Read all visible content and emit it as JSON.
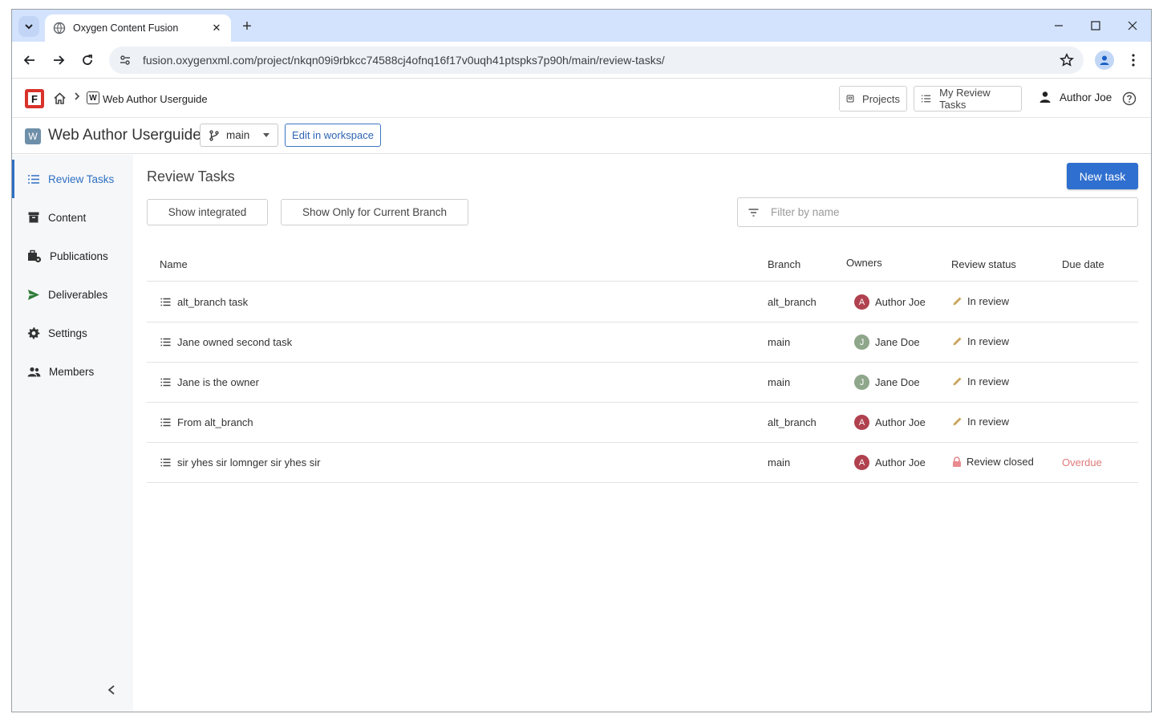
{
  "browser": {
    "tab_title": "Oxygen Content Fusion",
    "url": "fusion.oxygenxml.com/project/nkqn09i9rbkcc74588cj4ofnq16f17v0uqh41ptspks7p90h/main/review-tasks/"
  },
  "header": {
    "logo_letter": "F",
    "breadcrumb_project": "Web Author Userguide",
    "breadcrumb_project_icon": "W",
    "projects_label": "Projects",
    "my_review_tasks_label": "My Review Tasks",
    "user_name": "Author Joe"
  },
  "project_bar": {
    "icon_letter": "W",
    "title": "Web Author Userguide",
    "branch": "main",
    "edit_in_workspace": "Edit in workspace"
  },
  "sidebar": {
    "items": [
      {
        "label": "Review Tasks",
        "icon": "list-icon",
        "active": true
      },
      {
        "label": "Content",
        "icon": "archive-icon"
      },
      {
        "label": "Publications",
        "icon": "publications-icon"
      },
      {
        "label": "Deliverables",
        "icon": "send-icon"
      },
      {
        "label": "Settings",
        "icon": "gear-icon"
      },
      {
        "label": "Members",
        "icon": "members-icon"
      }
    ]
  },
  "main": {
    "title": "Review Tasks",
    "new_task_label": "New task",
    "show_integrated_label": "Show integrated",
    "show_current_branch_label": "Show Only for Current Branch",
    "filter_placeholder": "Filter by name",
    "columns": {
      "name": "Name",
      "branch": "Branch",
      "owners": "Owners",
      "status": "Review status",
      "due": "Due date"
    },
    "rows": [
      {
        "name": "alt_branch task",
        "branch": "alt_branch",
        "owner": "Author Joe",
        "owner_initial": "A",
        "status": "In review",
        "status_icon": "pencil-icon",
        "due": ""
      },
      {
        "name": "Jane owned second task",
        "branch": "main",
        "owner": "Jane Doe",
        "owner_initial": "J",
        "status": "In review",
        "status_icon": "pencil-icon",
        "due": ""
      },
      {
        "name": "Jane is the owner",
        "branch": "main",
        "owner": "Jane Doe",
        "owner_initial": "J",
        "status": "In review",
        "status_icon": "pencil-icon",
        "due": ""
      },
      {
        "name": "From alt_branch",
        "branch": "alt_branch",
        "owner": "Author Joe",
        "owner_initial": "A",
        "status": "In review",
        "status_icon": "pencil-icon",
        "due": ""
      },
      {
        "name": "sir yhes sir lomnger sir yhes sir",
        "branch": "main",
        "owner": "Author Joe",
        "owner_initial": "A",
        "status": "Review closed",
        "status_icon": "lock-icon",
        "due": "Overdue"
      }
    ]
  },
  "colors": {
    "accent": "#2f6fcf",
    "avatar_author": "#b0414e",
    "avatar_jane": "#8ea68a",
    "overdue": "#e07a7a",
    "pencil": "#c9a45c",
    "lock": "#e88a8f"
  }
}
